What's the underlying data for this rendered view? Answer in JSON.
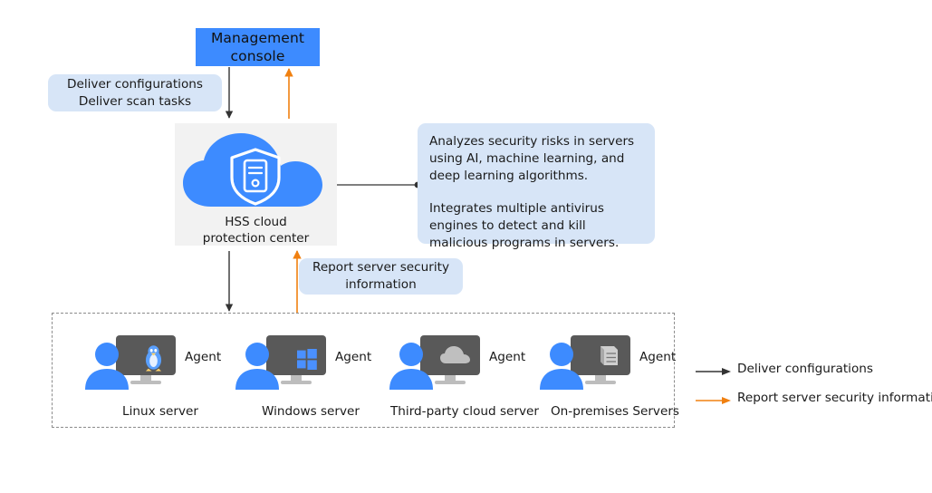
{
  "colors": {
    "brand_blue": "#3d8bff",
    "callout_blue": "#d7e5f7",
    "panel_gray": "#f2f2f2",
    "monitor_gray": "#595959",
    "glyph_gray": "#bfbfbf",
    "arrow_black": "#333333",
    "arrow_orange": "#f08010",
    "dash_gray": "#8c8c8c",
    "text": "#1a1a1a"
  },
  "management_console": {
    "label": "Management\nconsole"
  },
  "callouts": {
    "deliver": "Deliver configurations\nDeliver scan tasks",
    "report": "Report server security\ninformation",
    "analyze": {
      "paragraph_1": "Analyzes security risks in servers using AI, machine learning, and deep learning algorithms.",
      "paragraph_2": "Integrates multiple antivirus engines to detect and kill malicious programs in servers."
    }
  },
  "hss": {
    "label": "HSS cloud\nprotection center",
    "icon": "cloud-shield-server-icon"
  },
  "nodes": [
    {
      "label": "Linux server",
      "agent": "Agent",
      "icon": "linux-penguin-monitor-icon"
    },
    {
      "label": "Windows server",
      "agent": "Agent",
      "icon": "windows-logo-monitor-icon"
    },
    {
      "label": "Third-party cloud server",
      "agent": "Agent",
      "icon": "cloud-monitor-icon"
    },
    {
      "label": "On-premises Servers",
      "agent": "Agent",
      "icon": "server-rack-monitor-icon"
    }
  ],
  "legend": [
    {
      "label": "Deliver configurations",
      "color": "#333333"
    },
    {
      "label": "Report server security information",
      "color": "#f08010"
    }
  ]
}
